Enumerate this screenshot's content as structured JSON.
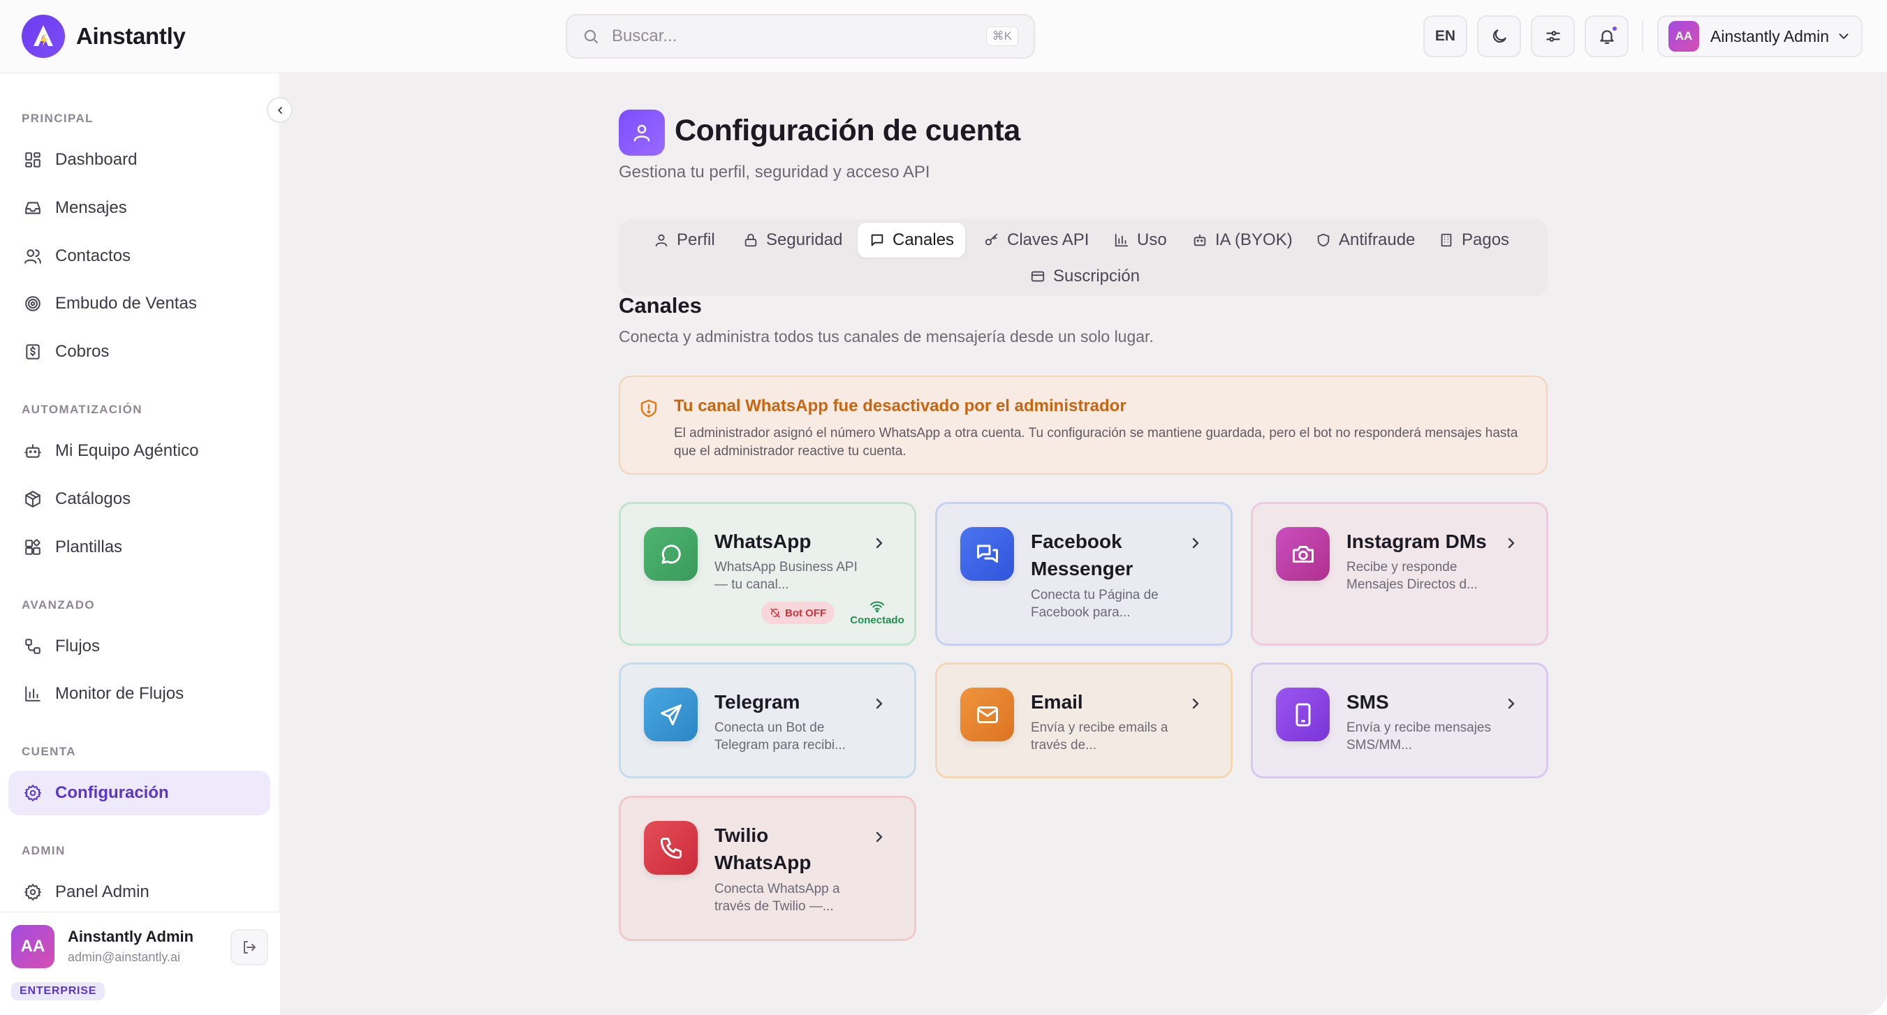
{
  "app": {
    "name": "Ainstantly"
  },
  "search": {
    "placeholder": "Buscar...",
    "shortcut": "⌘K"
  },
  "topbar": {
    "lang": "EN",
    "user_initials": "AA",
    "user_name": "Ainstantly Admin"
  },
  "sidebar": {
    "sections": {
      "principal": "PRINCIPAL",
      "automatizacion": "AUTOMATIZACIÓN",
      "avanzado": "AVANZADO",
      "cuenta": "CUENTA",
      "admin": "ADMIN"
    },
    "items": [
      {
        "label": "Dashboard",
        "icon": "dashboard-icon"
      },
      {
        "label": "Mensajes",
        "icon": "inbox-icon"
      },
      {
        "label": "Contactos",
        "icon": "users-icon"
      },
      {
        "label": "Embudo de Ventas",
        "icon": "target-icon"
      },
      {
        "label": "Cobros",
        "icon": "dollar-receipt-icon"
      },
      {
        "label": "Mi Equipo Agéntico",
        "icon": "bot-icon"
      },
      {
        "label": "Catálogos",
        "icon": "package-icon"
      },
      {
        "label": "Plantillas",
        "icon": "template-icon"
      },
      {
        "label": "Flujos",
        "icon": "workflow-icon"
      },
      {
        "label": "Monitor de Flujos",
        "icon": "bar-chart-icon"
      },
      {
        "label": "Configuración",
        "icon": "settings-icon",
        "active": true
      },
      {
        "label": "Panel Admin",
        "icon": "settings-icon"
      }
    ],
    "footer": {
      "initials": "AA",
      "name": "Ainstantly Admin",
      "email": "admin@ainstantly.ai",
      "plan": "ENTERPRISE"
    }
  },
  "page": {
    "title": "Configuración de cuenta",
    "subtitle": "Gestiona tu perfil, seguridad y acceso API"
  },
  "tabs": [
    {
      "label": "Perfil",
      "icon": "user-icon"
    },
    {
      "label": "Seguridad",
      "icon": "lock-icon"
    },
    {
      "label": "Canales",
      "icon": "message-square-icon",
      "active": true
    },
    {
      "label": "Claves API",
      "icon": "key-icon"
    },
    {
      "label": "Uso",
      "icon": "bar-chart-icon"
    },
    {
      "label": "IA (BYOK)",
      "icon": "bot-icon"
    },
    {
      "label": "Antifraude",
      "icon": "shield-icon"
    },
    {
      "label": "Pagos",
      "icon": "building-icon"
    },
    {
      "label": "Suscripción",
      "icon": "credit-card-icon"
    }
  ],
  "channels_section": {
    "title": "Canales",
    "subtitle": "Conecta y administra todos tus canales de mensajería desde un solo lugar."
  },
  "alert": {
    "title": "Tu canal WhatsApp fue desactivado por el administrador",
    "body": "El administrador asignó el número WhatsApp a otra cuenta. Tu configuración se mantiene guardada, pero el bot no responderá mensajes hasta que el administrador reactive tu cuenta."
  },
  "channels": [
    {
      "name": "WhatsApp",
      "desc": "WhatsApp Business API — tu canal...",
      "bot_status": "Bot OFF",
      "conn_status": "Conectado"
    },
    {
      "name": "Facebook Messenger",
      "desc": "Conecta tu Página de Facebook para..."
    },
    {
      "name": "Instagram DMs",
      "desc": "Recibe y responde Mensajes Directos d..."
    },
    {
      "name": "Telegram",
      "desc": "Conecta un Bot de Telegram para recibi..."
    },
    {
      "name": "Email",
      "desc": "Envía y recibe emails a través de..."
    },
    {
      "name": "SMS",
      "desc": "Envía y recibe mensajes SMS/MM..."
    },
    {
      "name": "Twilio WhatsApp",
      "desc": "Conecta WhatsApp a través de Twilio —..."
    }
  ],
  "colors": {
    "accent": "#7c4dff",
    "whatsapp": "#3fa35f",
    "facebook": "#3b63e8",
    "instagram": "#c43fa4",
    "telegram": "#3596d3",
    "email": "#e8822e",
    "sms": "#8a45e6",
    "twilio": "#d93a46",
    "alert": "#c9650f"
  }
}
